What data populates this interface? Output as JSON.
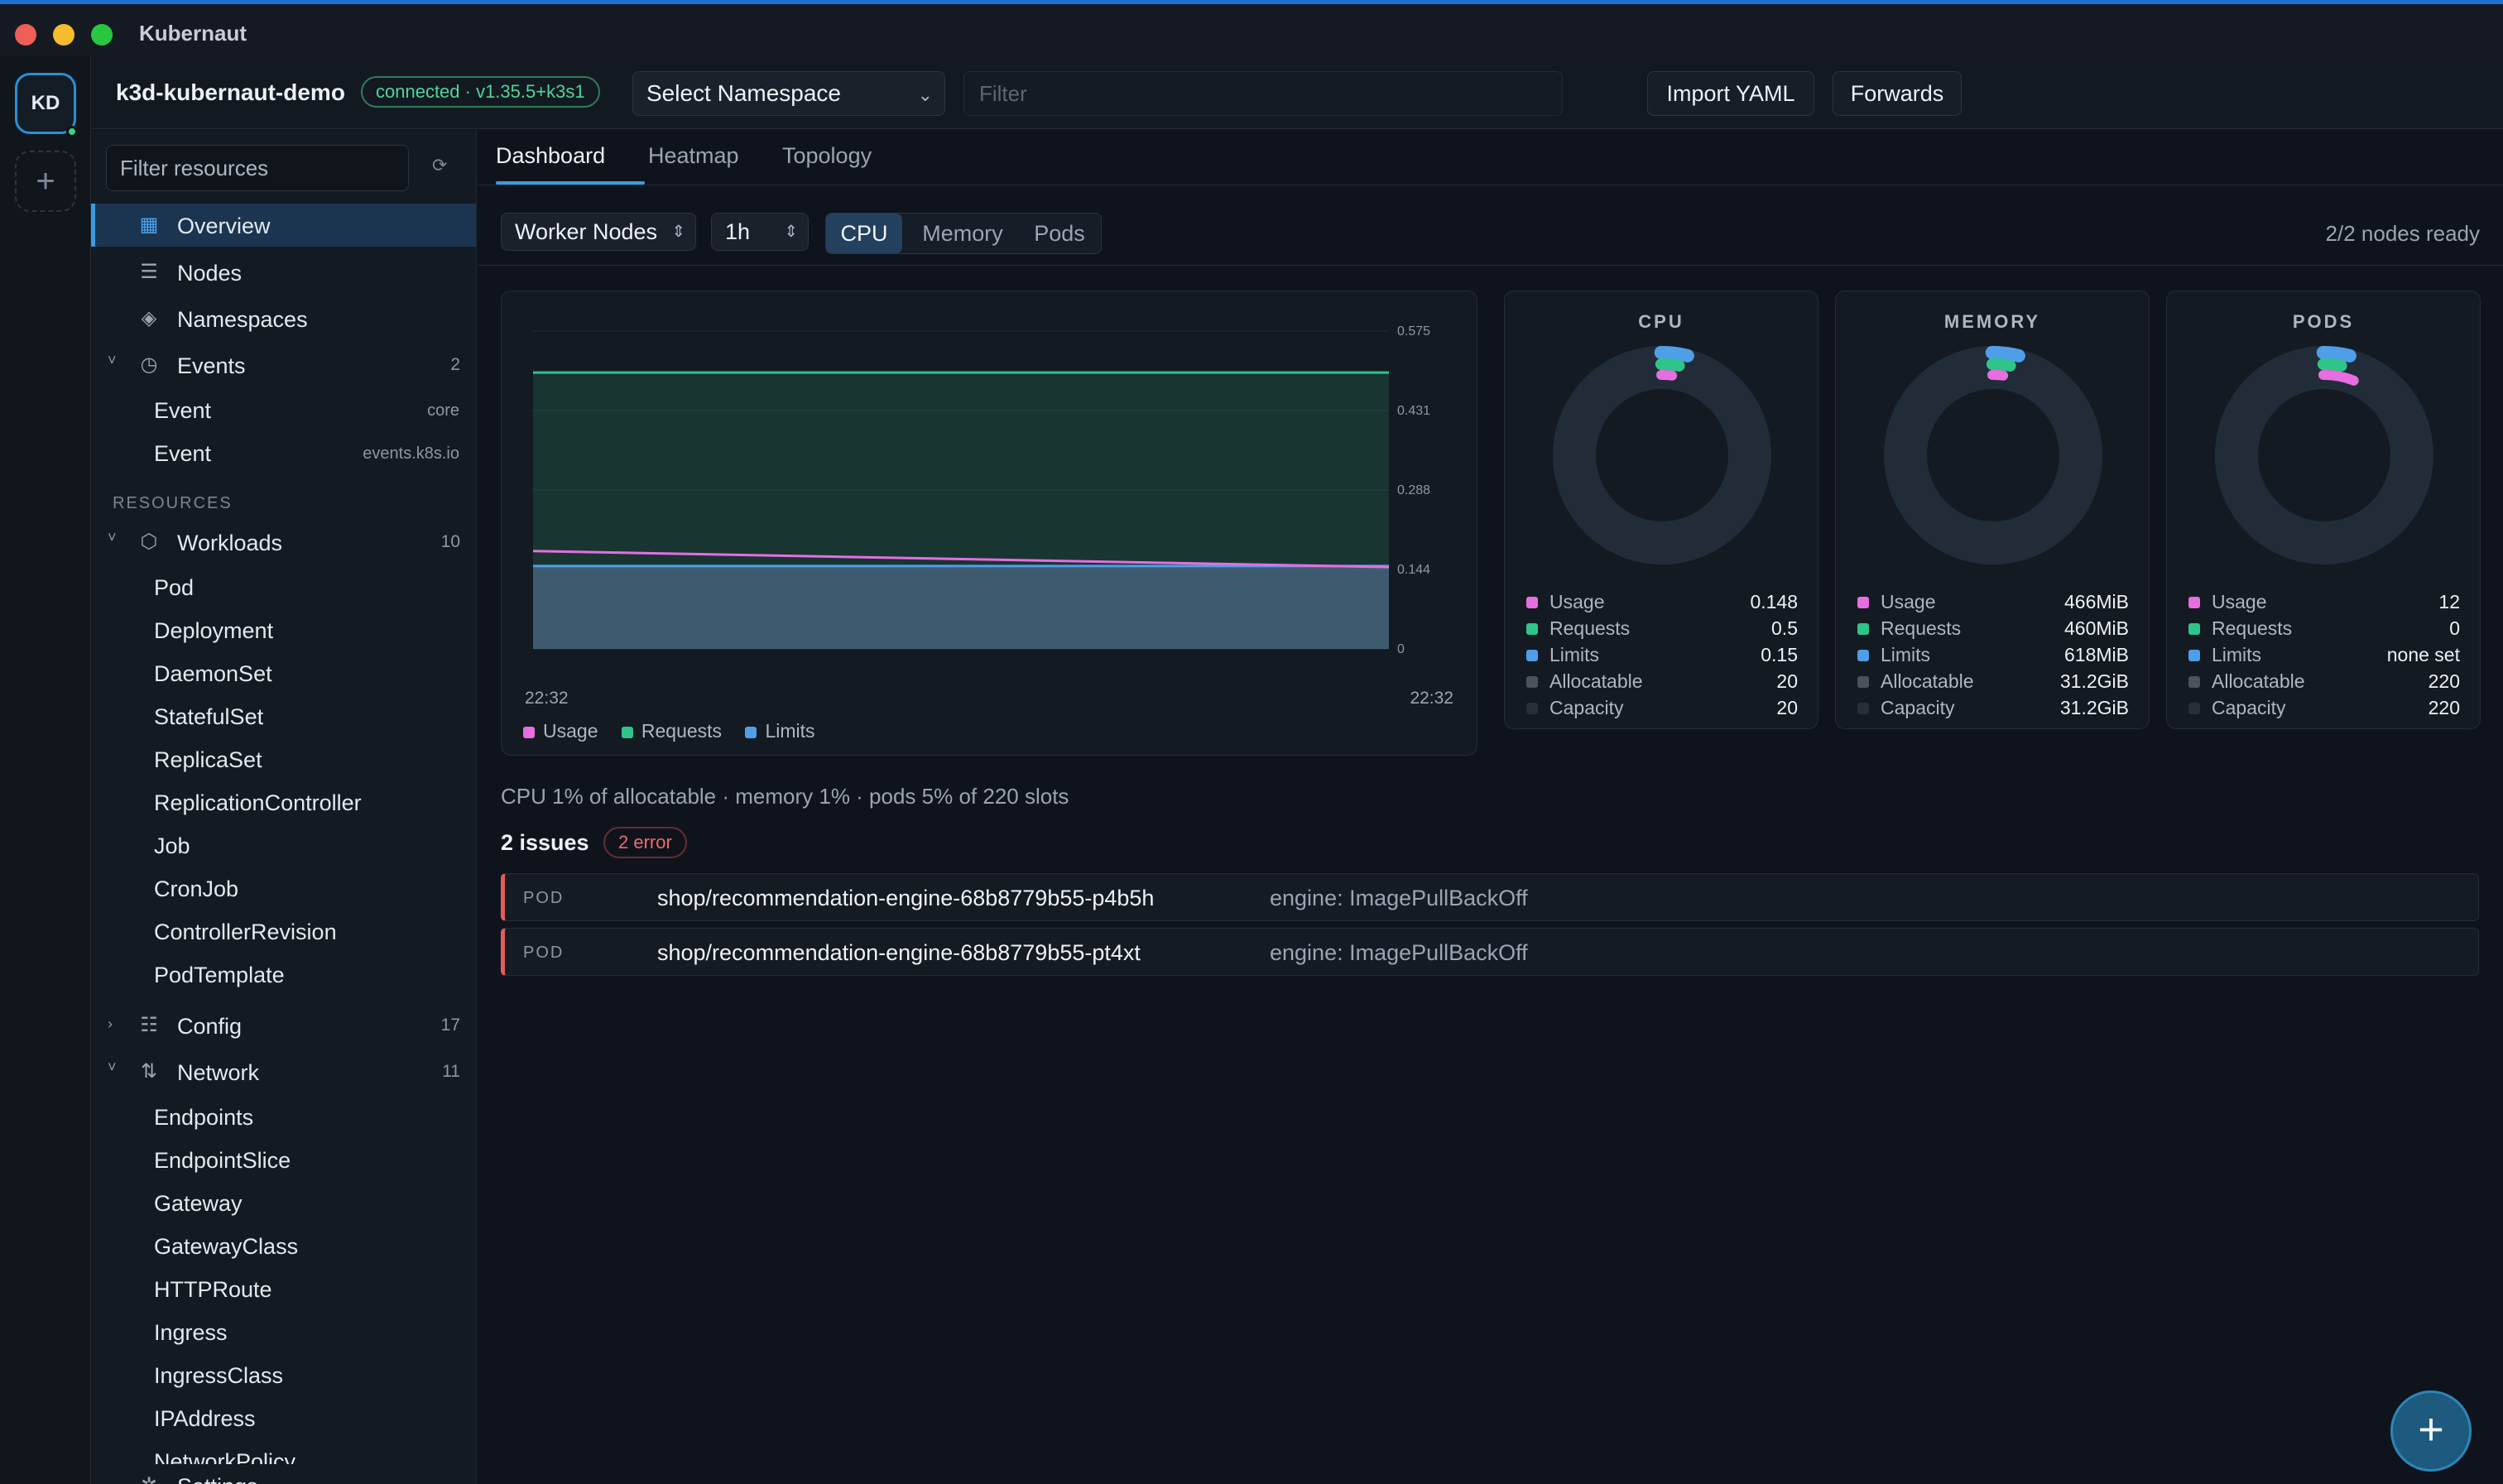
{
  "window": {
    "title": "Kubernaut",
    "traffic_colors": [
      "#ee5f57",
      "#f5bd2e",
      "#27c840"
    ]
  },
  "rail": {
    "avatar": "KD",
    "add_label": "+"
  },
  "header": {
    "context": "k3d-kubernaut-demo",
    "status": "connected · v1.35.5+k3s1",
    "namespace_select": "Select Namespace",
    "filter_placeholder": "Filter",
    "import_yaml": "Import YAML",
    "forwards": "Forwards"
  },
  "sidebar": {
    "filter_placeholder": "Filter resources",
    "overview": "Overview",
    "nodes": "Nodes",
    "namespaces": "Namespaces",
    "events": {
      "label": "Events",
      "count": "2",
      "children": [
        {
          "label": "Event",
          "meta": "core"
        },
        {
          "label": "Event",
          "meta": "events.k8s.io"
        }
      ]
    },
    "resources_section": "RESOURCES",
    "workloads": {
      "label": "Workloads",
      "count": "10",
      "children": [
        "Pod",
        "Deployment",
        "DaemonSet",
        "StatefulSet",
        "ReplicaSet",
        "ReplicationController",
        "Job",
        "CronJob",
        "ControllerRevision",
        "PodTemplate"
      ]
    },
    "config": {
      "label": "Config",
      "count": "17"
    },
    "network": {
      "label": "Network",
      "count": "11",
      "children": [
        "Endpoints",
        "EndpointSlice",
        "Gateway",
        "GatewayClass",
        "HTTPRoute",
        "Ingress",
        "IngressClass",
        "IPAddress",
        "NetworkPolicy"
      ]
    },
    "settings": "Settings"
  },
  "main": {
    "tabs": [
      "Dashboard",
      "Heatmap",
      "Topology"
    ],
    "node_select": "Worker Nodes",
    "range_select": "1h",
    "metric_tabs": [
      "CPU",
      "Memory",
      "Pods"
    ],
    "nodes_ready": "2/2 nodes ready",
    "summary": "CPU 1% of allocatable · memory 1% · pods 5% of 220 slots",
    "issues_title": "2 issues",
    "issues_badge": "2 error",
    "issues": [
      {
        "kind": "POD",
        "name": "shop/recommendation-engine-68b8779b55-p4b5h",
        "message": "engine: ImagePullBackOff"
      },
      {
        "kind": "POD",
        "name": "shop/recommendation-engine-68b8779b55-pt4xt",
        "message": "engine: ImagePullBackOff"
      }
    ]
  },
  "chart_data": [
    {
      "type": "area",
      "x": [
        "22:32",
        "22:32"
      ],
      "ytick_labels": [
        "0.575",
        "0.431",
        "0.288",
        "0.144",
        "0"
      ],
      "ylim": [
        0,
        0.575
      ],
      "series": [
        {
          "name": "Usage",
          "color": "#e66ee0",
          "values": [
            0.177,
            0.148
          ]
        },
        {
          "name": "Requests",
          "color": "#2fc48a",
          "values": [
            0.5,
            0.5
          ]
        },
        {
          "name": "Limits",
          "color": "#4f9ee8",
          "values": [
            0.15,
            0.15
          ]
        }
      ]
    }
  ],
  "gauges": [
    {
      "title": "CPU",
      "rows": [
        {
          "label": "Usage",
          "value": "0.148",
          "color": "#e66ee0"
        },
        {
          "label": "Requests",
          "value": "0.5",
          "color": "#2fc48a"
        },
        {
          "label": "Limits",
          "value": "0.15",
          "color": "#4f9ee8"
        },
        {
          "label": "Allocatable",
          "value": "20",
          "color": "#4a525d"
        },
        {
          "label": "Capacity",
          "value": "20",
          "color": "#262e38"
        }
      ]
    },
    {
      "title": "MEMORY",
      "rows": [
        {
          "label": "Usage",
          "value": "466MiB",
          "color": "#e66ee0"
        },
        {
          "label": "Requests",
          "value": "460MiB",
          "color": "#2fc48a"
        },
        {
          "label": "Limits",
          "value": "618MiB",
          "color": "#4f9ee8"
        },
        {
          "label": "Allocatable",
          "value": "31.2GiB",
          "color": "#4a525d"
        },
        {
          "label": "Capacity",
          "value": "31.2GiB",
          "color": "#262e38"
        }
      ]
    },
    {
      "title": "PODS",
      "rows": [
        {
          "label": "Usage",
          "value": "12",
          "color": "#e66ee0"
        },
        {
          "label": "Requests",
          "value": "0",
          "color": "#2fc48a"
        },
        {
          "label": "Limits",
          "value": "none set",
          "color": "#4f9ee8"
        },
        {
          "label": "Allocatable",
          "value": "220",
          "color": "#4a525d"
        },
        {
          "label": "Capacity",
          "value": "220",
          "color": "#262e38"
        }
      ]
    }
  ],
  "fab_label": "+"
}
